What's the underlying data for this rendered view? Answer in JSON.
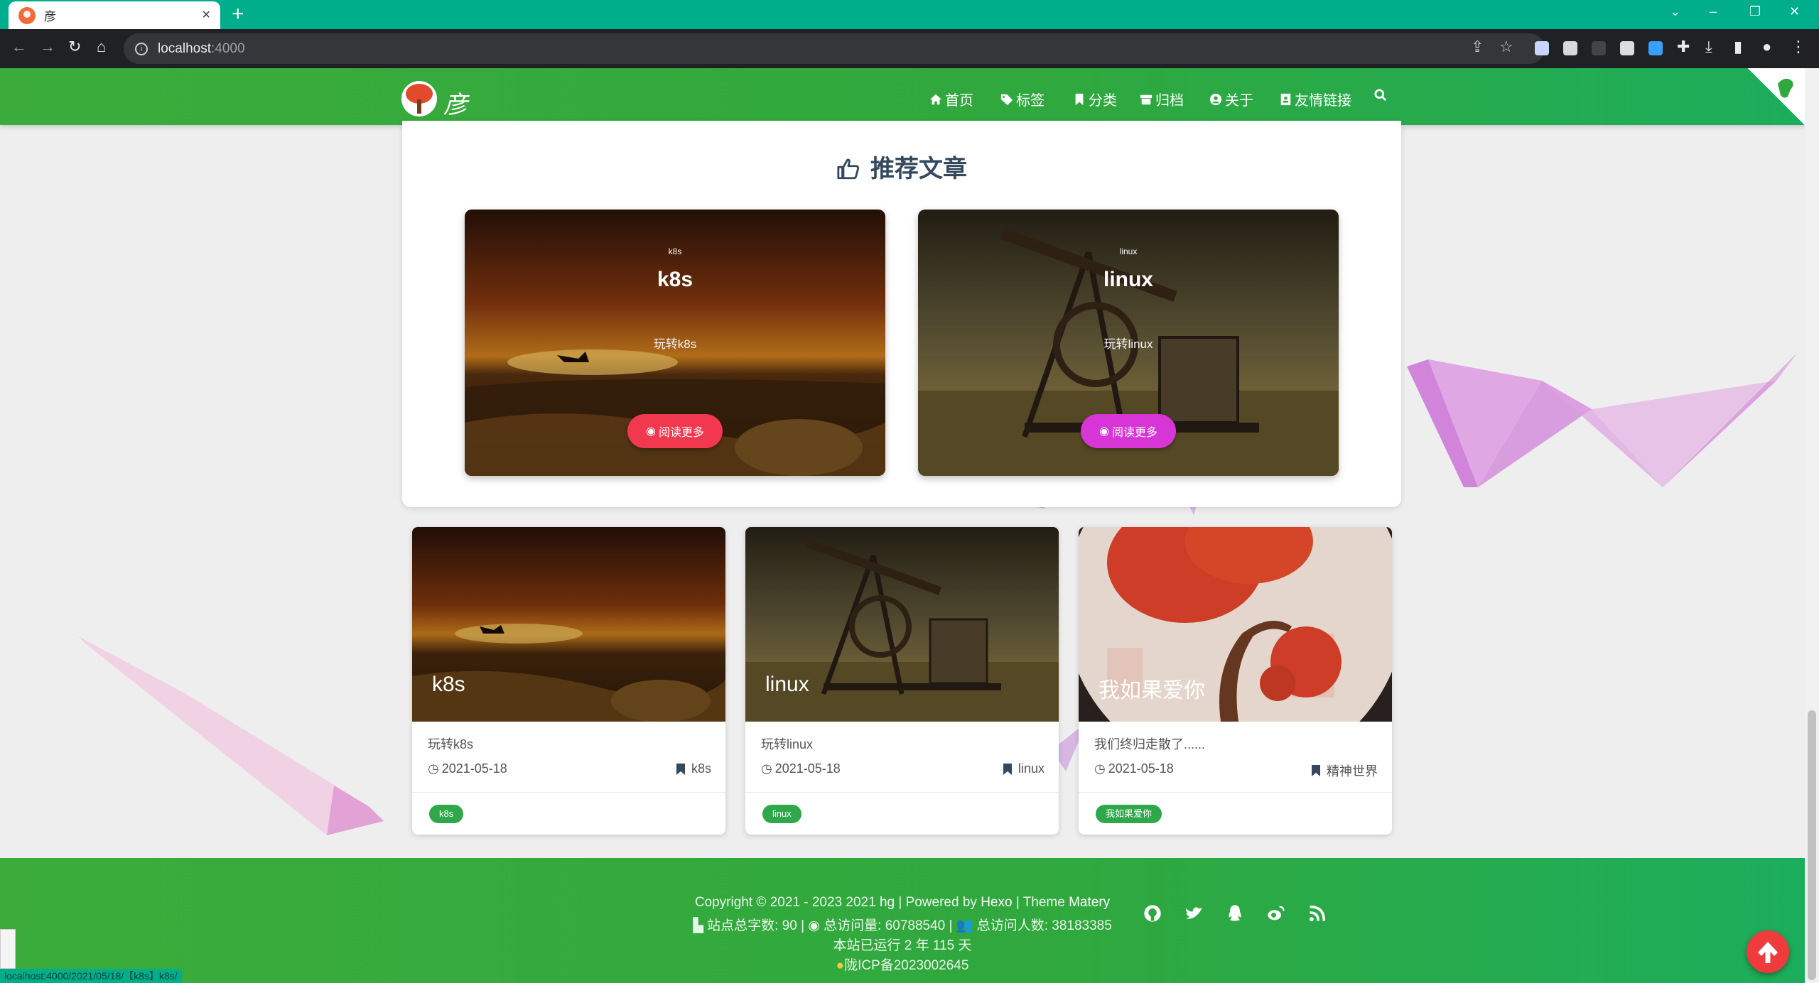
{
  "browser": {
    "tab_title": "彦",
    "tab_close": "×",
    "new_tab": "+",
    "url_host": "localhost",
    "url_port": ":4000",
    "status_url": "localhost:4000/2021/05/18/【k8s】k8s/"
  },
  "header": {
    "site_name": "彦",
    "menu": [
      "首页",
      "标签",
      "分类",
      "归档",
      "关于",
      "友情链接"
    ]
  },
  "recommend": {
    "title": "推荐文章",
    "cards": [
      {
        "category_small": "k8s",
        "category": "k8s",
        "desc": "玩转k8s",
        "button": "阅读更多",
        "button_color": "#f2384f"
      },
      {
        "category_small": "linux",
        "category": "linux",
        "desc": "玩转linux",
        "button": "阅读更多",
        "button_color": "#d735d6"
      }
    ]
  },
  "articles": [
    {
      "image_title": "k8s",
      "summary": "玩转k8s",
      "date": "2021-05-18",
      "category": "k8s",
      "tag": "k8s"
    },
    {
      "image_title": "linux",
      "summary": "玩转linux",
      "date": "2021-05-18",
      "category": "linux",
      "tag": "linux"
    },
    {
      "image_title": "我如果爱你",
      "summary": "我们终归走散了......",
      "date": "2021-05-18",
      "category": "精神世界",
      "tag": "我如果爱你"
    }
  ],
  "footer": {
    "copyright_prefix": "Copyright © 2021 - 2023 2021 ",
    "author": "hg",
    "powered_prefix": " | Powered by ",
    "powered": "Hexo",
    "theme_prefix": " | Theme ",
    "theme": "Matery",
    "stats_words_label": "站点总字数: ",
    "stats_words": "90",
    "stats_views_label": "总访问量: ",
    "stats_views": "60788540",
    "stats_visitors_label": "总访问人数: ",
    "stats_visitors": "38183385",
    "runtime": "本站已运行 2 年 115 天",
    "icp": "陇ICP备2023002645"
  },
  "colors": {
    "brand_green": "#2fa83e",
    "tab_teal": "#00ae8c",
    "back_top": "#ef3b3b"
  }
}
